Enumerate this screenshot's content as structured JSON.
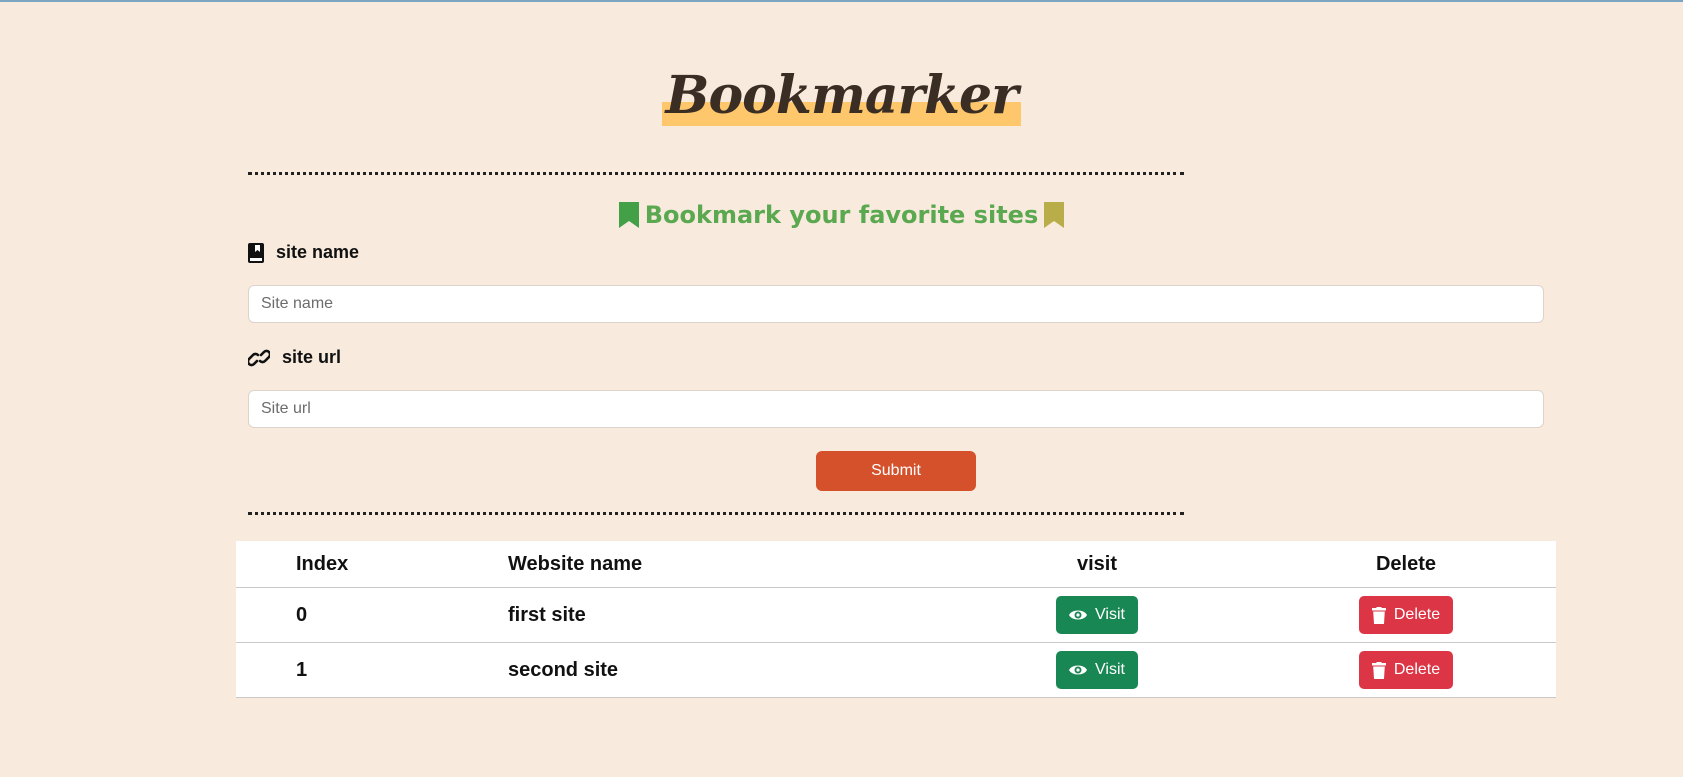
{
  "header": {
    "title": "Bookmarker"
  },
  "subtitle": "Bookmark your favorite sites",
  "form": {
    "site_name_label": "site name",
    "site_name_placeholder": "Site name",
    "site_url_label": "site url",
    "site_url_placeholder": "Site url",
    "submit_label": "Submit"
  },
  "table": {
    "headers": [
      "Index",
      "Website name",
      "visit",
      "Delete"
    ],
    "rows": [
      {
        "index": "0",
        "name": "first site",
        "visit_label": "Visit",
        "delete_label": "Delete"
      },
      {
        "index": "1",
        "name": "second site",
        "visit_label": "Visit",
        "delete_label": "Delete"
      }
    ]
  },
  "colors": {
    "background": "#f8ebde",
    "title_highlight": "#ffc76b",
    "subtitle_green": "#5aa84f",
    "bookmark_right": "#b9ad4a",
    "submit": "#d4512b",
    "visit": "#198754",
    "delete": "#dc3545"
  },
  "icons": [
    "bookmark-icon",
    "book-icon",
    "link-icon",
    "eye-icon",
    "trash-icon"
  ]
}
